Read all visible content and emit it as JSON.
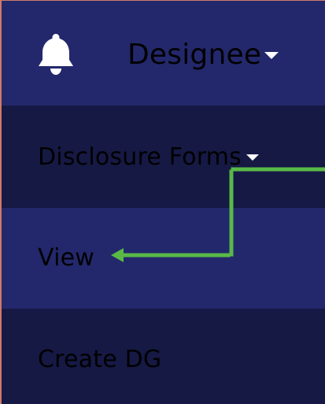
{
  "header": {
    "bell_icon": "bell-icon",
    "role_label": "Designee",
    "role_dropdown_icon": "caret-down-icon"
  },
  "menu": {
    "disclosure_forms": "Disclosure Forms",
    "disclosure_forms_icon": "caret-down-icon",
    "view": "View",
    "create_dg": "Create DG"
  },
  "annotation": {
    "type": "dotted-arrow",
    "color": "#59b947"
  },
  "colors": {
    "header_bg": "#23286c",
    "menu_dark_bg": "#161944",
    "menu_light_bg": "#23286c",
    "text": "#ffffff",
    "border": "#cf7966"
  }
}
